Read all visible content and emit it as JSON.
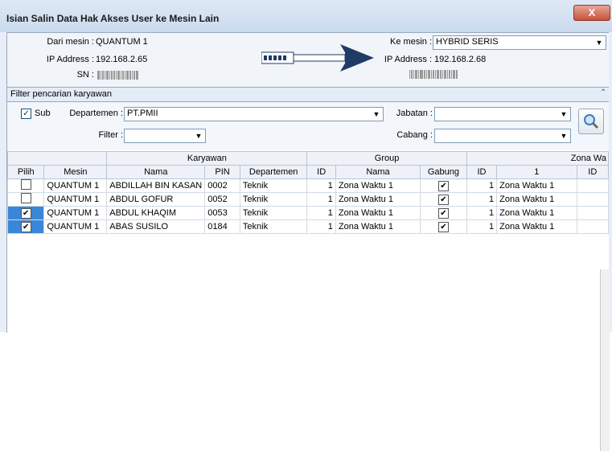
{
  "window": {
    "title": "Isian Salin Data Hak Akses User ke Mesin Lain",
    "close_glyph": "X"
  },
  "source": {
    "mesin_label": "Dari mesin :",
    "mesin": "QUANTUM 1",
    "ip_label": "IP Address :",
    "ip": "192.168.2.65",
    "sn_label": "SN :"
  },
  "target": {
    "mesin_label": "Ke mesin :",
    "mesin": "HYBRID SERIS",
    "ip_label": "IP Address :",
    "ip": "192.168.2.68"
  },
  "filter": {
    "header": "Filter pencarian karyawan",
    "sub_label": "Sub",
    "sub_checked": true,
    "departemen_label": "Departemen :",
    "departemen": "PT.PMII",
    "jabatan_label": "Jabatan :",
    "jabatan": "",
    "filter_label": "Filter :",
    "filter": "",
    "cabang_label": "Cabang :",
    "cabang": ""
  },
  "grid": {
    "groups": [
      "Karyawan",
      "Group",
      "Zona Wa"
    ],
    "columns": [
      "Pilih",
      "Mesin",
      "Nama",
      "PIN",
      "Departemen",
      "ID",
      "Nama",
      "Gabung",
      "ID",
      "1",
      "ID"
    ],
    "rows": [
      {
        "pilih": false,
        "mesin": "QUANTUM 1",
        "nama": "ABDILLAH BIN KASAN",
        "pin": "0002",
        "dept": "Teknik",
        "gid": "1",
        "gnama": "Zona Waktu 1",
        "gabung": true,
        "zid": "1",
        "z1": "Zona Waktu 1"
      },
      {
        "pilih": false,
        "mesin": "QUANTUM 1",
        "nama": "ABDUL GOFUR",
        "pin": "0052",
        "dept": "Teknik",
        "gid": "1",
        "gnama": "Zona Waktu 1",
        "gabung": true,
        "zid": "1",
        "z1": "Zona Waktu 1"
      },
      {
        "pilih": true,
        "mesin": "QUANTUM 1",
        "nama": "ABDUL KHAQIM",
        "pin": "0053",
        "dept": "Teknik",
        "gid": "1",
        "gnama": "Zona Waktu 1",
        "gabung": true,
        "zid": "1",
        "z1": "Zona Waktu 1"
      },
      {
        "pilih": true,
        "mesin": "QUANTUM 1",
        "nama": "ABAS SUSILO",
        "pin": "0184",
        "dept": "Teknik",
        "gid": "1",
        "gnama": "Zona Waktu 1",
        "gabung": true,
        "zid": "1",
        "z1": "Zona Waktu 1"
      }
    ]
  },
  "icons": {
    "arrow": "arrow-right-icon",
    "search": "magnifier-icon",
    "collapse": "double-chevron-up-icon"
  },
  "colors": {
    "accent": "#1f3b66",
    "selection": "#3a86d8"
  }
}
